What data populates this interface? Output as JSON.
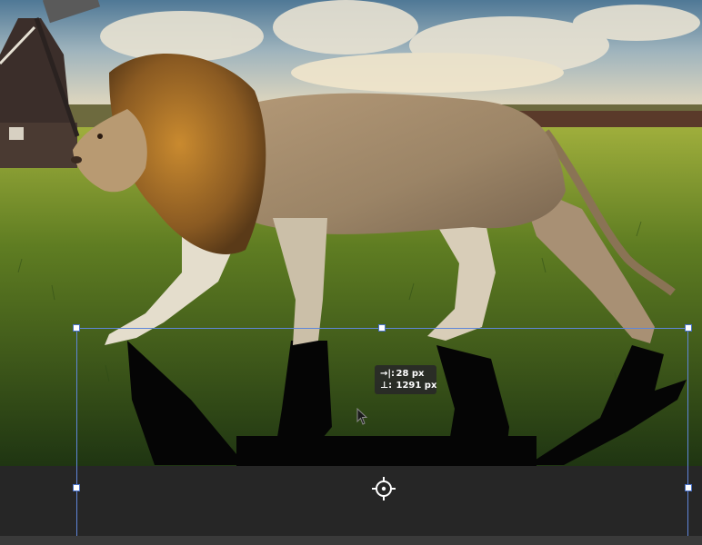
{
  "readout": {
    "delta_x_symbol": "→|:",
    "delta_x_value": "28 px",
    "delta_y_symbol": "⊥:",
    "delta_y_value": "1291 px"
  },
  "icons": {
    "pivot": "reference-point-crosshair-icon",
    "cursor": "arrow-cursor-icon",
    "transform_handles": "transform-handle-icon"
  },
  "colors": {
    "selection_border": "#5f86d9",
    "handle_fill": "#ffffff",
    "workspace_bg": "#262626",
    "readout_bg": "#282828"
  }
}
